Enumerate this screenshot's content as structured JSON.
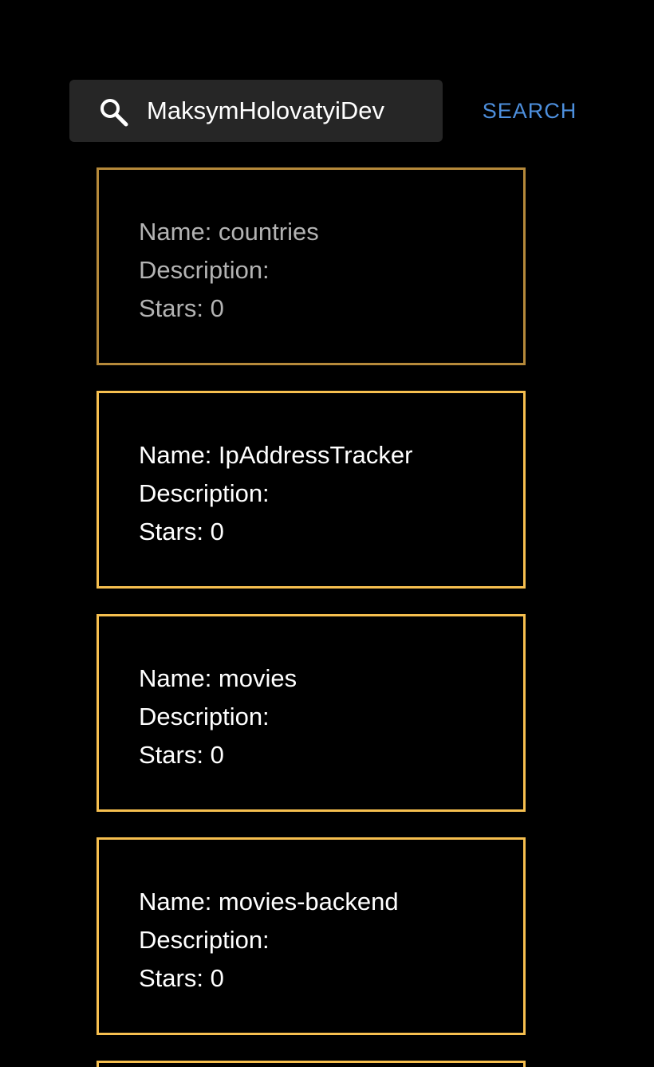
{
  "search": {
    "value": "MaksymHolovatyiDev",
    "button_label": "SEARCH",
    "icon": "search-icon"
  },
  "repos": [
    {
      "name_line": "Name: countries",
      "description_line": "Description:",
      "stars_line": "Stars: 0"
    },
    {
      "name_line": "Name: IpAddressTracker",
      "description_line": "Description:",
      "stars_line": "Stars: 0"
    },
    {
      "name_line": "Name: movies",
      "description_line": "Description:",
      "stars_line": "Stars: 0"
    },
    {
      "name_line": "Name: movies-backend",
      "description_line": "Description:",
      "stars_line": "Stars: 0"
    }
  ],
  "colors": {
    "background": "#000000",
    "card_border": "#f6bf4f",
    "card_border_dimmed": "#b5893a",
    "search_button": "#4d8fdd",
    "search_bar": "#262626"
  }
}
